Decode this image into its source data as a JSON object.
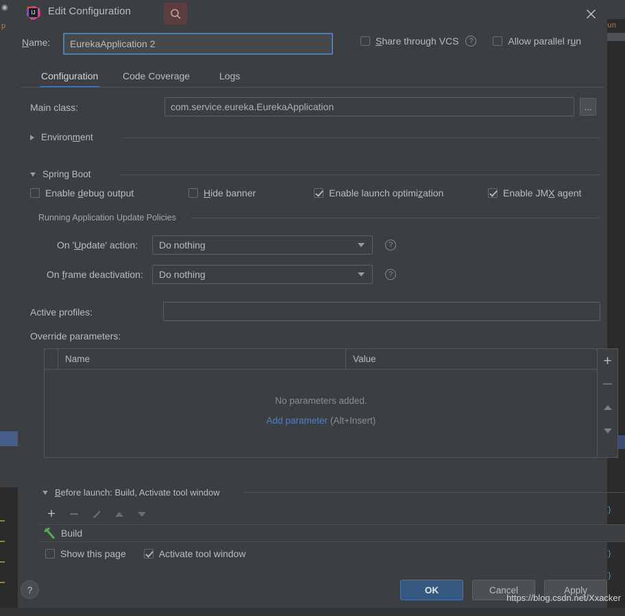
{
  "window": {
    "title": "Edit Configuration",
    "logo_icon": "intellij-idea-logo",
    "search_icon": "search-icon",
    "close_icon": "close-icon"
  },
  "name_row": {
    "label": "Name:",
    "value": "EurekaApplication 2",
    "share_vcs": {
      "label": "Share through VCS",
      "checked": false,
      "help_icon": "help-circle-icon"
    },
    "allow_parallel": {
      "label": "Allow parallel run",
      "checked": false
    }
  },
  "tabs": [
    {
      "label": "Configuration",
      "active": true
    },
    {
      "label": "Code Coverage",
      "active": false
    },
    {
      "label": "Logs",
      "active": false
    }
  ],
  "main_class": {
    "label": "Main class:",
    "value": "com.service.eureka.EurekaApplication",
    "browse_label": "..."
  },
  "environment": {
    "label": "Environment",
    "expanded": false,
    "chevron_icon": "chevron-right-icon"
  },
  "spring_boot": {
    "label": "Spring Boot",
    "expanded": true,
    "chevron_icon": "chevron-down-icon",
    "checkboxes": [
      {
        "label": "Enable debug output",
        "checked": false
      },
      {
        "label": "Hide banner",
        "checked": false
      },
      {
        "label": "Enable launch optimization",
        "checked": true
      },
      {
        "label": "Enable JMX agent",
        "checked": true
      }
    ],
    "update_policies": {
      "group_label": "Running Application Update Policies",
      "rows": [
        {
          "label": "On 'Update' action:",
          "value": "Do nothing",
          "help_icon": "help-circle-icon"
        },
        {
          "label": "On frame deactivation:",
          "value": "Do nothing",
          "help_icon": "help-circle-icon"
        }
      ]
    },
    "active_profiles": {
      "label": "Active profiles:",
      "value": "",
      "placeholder": ""
    },
    "override_parameters": {
      "label": "Override parameters:",
      "columns": [
        "Name",
        "Value"
      ],
      "rows": [],
      "empty_text": "No parameters added.",
      "add_link": "Add parameter",
      "add_hint": "(Alt+Insert)",
      "side_buttons": [
        {
          "name": "add-parameter-button",
          "icon": "plus-icon"
        },
        {
          "name": "remove-parameter-button",
          "icon": "minus-icon"
        },
        {
          "name": "move-parameter-up-button",
          "icon": "arrow-up-icon"
        },
        {
          "name": "move-parameter-down-button",
          "icon": "arrow-down-icon"
        }
      ]
    }
  },
  "before_launch": {
    "label": "Before launch: Build, Activate tool window",
    "expanded": true,
    "chevron_icon": "chevron-down-icon",
    "toolbar": [
      {
        "name": "add-task-button",
        "icon": "plus-icon",
        "enabled": true
      },
      {
        "name": "remove-task-button",
        "icon": "minus-icon",
        "enabled": false
      },
      {
        "name": "edit-task-button",
        "icon": "pencil-icon",
        "enabled": false
      },
      {
        "name": "move-task-up-button",
        "icon": "arrow-up-icon",
        "enabled": false
      },
      {
        "name": "move-task-down-button",
        "icon": "arrow-down-icon",
        "enabled": false
      }
    ],
    "items": [
      {
        "label": "Build",
        "icon": "build-hammer-icon"
      }
    ],
    "show_this_page": {
      "label": "Show this page",
      "checked": false
    },
    "activate_tool_window": {
      "label": "Activate tool window",
      "checked": true
    }
  },
  "footer": {
    "help_icon": "question-mark-icon",
    "buttons": [
      {
        "label": "OK",
        "style": "primary"
      },
      {
        "label": "Cancel",
        "style": "default"
      },
      {
        "label": "Apply",
        "style": "default"
      }
    ]
  },
  "watermark": "https://blog.csdn.net/Xxacker",
  "colors": {
    "dialog_bg": "#3c3f41",
    "editor_bg": "#2b2b2b",
    "accent_blue": "#4a88c7",
    "link_blue": "#4c7ecf",
    "primary_button": "#365880",
    "text": "#bbbbbb",
    "muted_text": "#8c8c8c",
    "build_icon_green": "#5aa85a",
    "search_highlight": "#5c3c3e"
  },
  "background_editor": {
    "left_glyphs": [
      "⊙",
      "p"
    ],
    "right_fragments": [
      "un",
      "}",
      "}",
      "}",
      "}"
    ]
  }
}
